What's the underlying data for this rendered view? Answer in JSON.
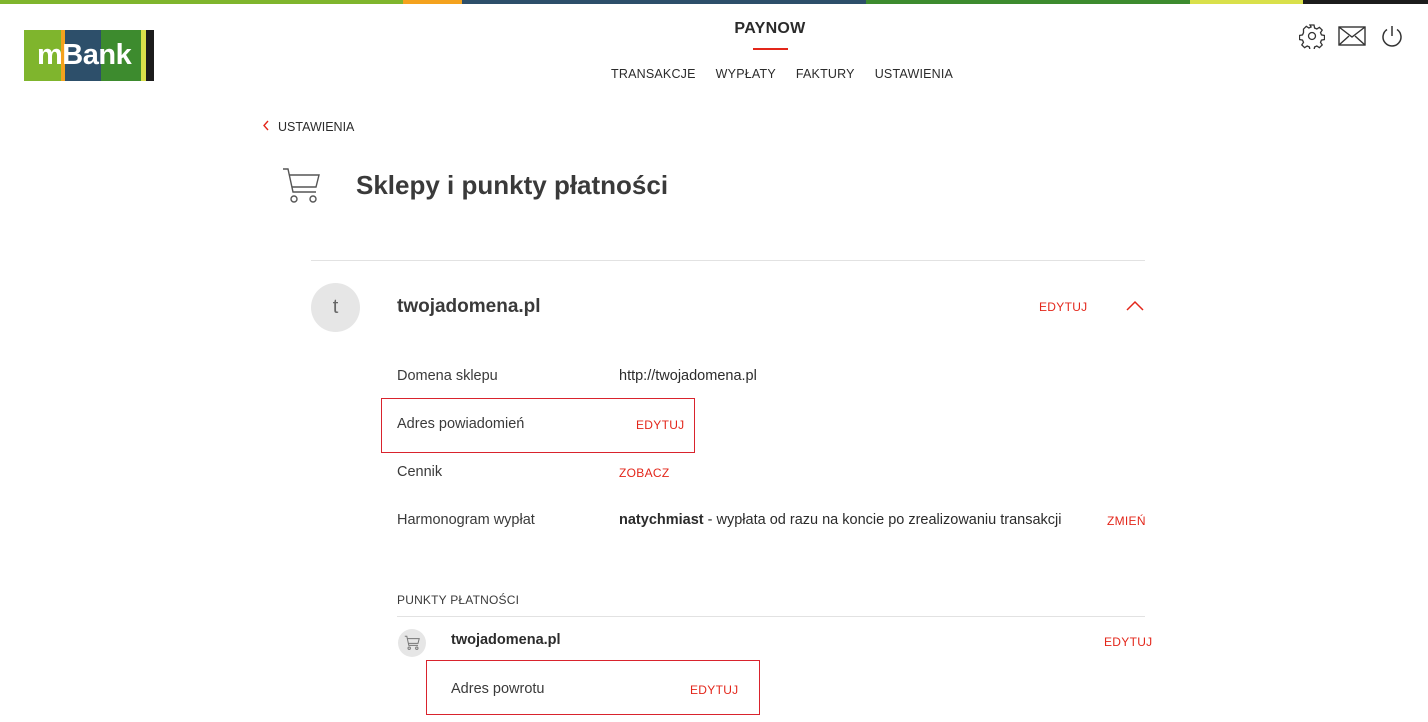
{
  "colors": {
    "accent": "#e3261a",
    "stripe": [
      "#7fb52d",
      "#f4a21e",
      "#2d4f6a",
      "#3d8b2e",
      "#d9e04a",
      "#1c1c1c"
    ]
  },
  "logo": {
    "text": "mBank"
  },
  "header": {
    "brand": "PAYNOW",
    "nav": [
      "TRANSAKCJE",
      "WYPŁATY",
      "FAKTURY",
      "USTAWIENIA"
    ],
    "icons": [
      "gear-icon",
      "mail-icon",
      "power-icon"
    ]
  },
  "breadcrumb": {
    "back_label": "USTAWIENIA",
    "icon": "chevron-left-icon"
  },
  "page": {
    "title": "Sklepy i punkty płatności",
    "icon": "cart-icon"
  },
  "shop": {
    "avatar_letter": "t",
    "name": "twojadomena.pl",
    "edit_label": "EDYTUJ",
    "collapse_icon": "chevron-up-icon",
    "details": {
      "domain_label": "Domena sklepu",
      "domain_value": "http://twojadomena.pl",
      "notify_label": "Adres powiadomień",
      "notify_action": "EDYTUJ",
      "pricing_label": "Cennik",
      "pricing_action": "ZOBACZ",
      "schedule_label": "Harmonogram wypłat",
      "schedule_value_bold": "natychmiast",
      "schedule_value_rest": " - wypłata od razu na koncie po zrealizowaniu transakcji",
      "schedule_action": "ZMIEŃ"
    }
  },
  "payment_points": {
    "section_title": "PUNKTY PŁATNOŚCI",
    "items": [
      {
        "name": "twojadomena.pl",
        "edit_label": "EDYTUJ",
        "icon": "cart-icon",
        "return_label": "Adres powrotu",
        "return_action": "EDYTUJ"
      }
    ]
  }
}
